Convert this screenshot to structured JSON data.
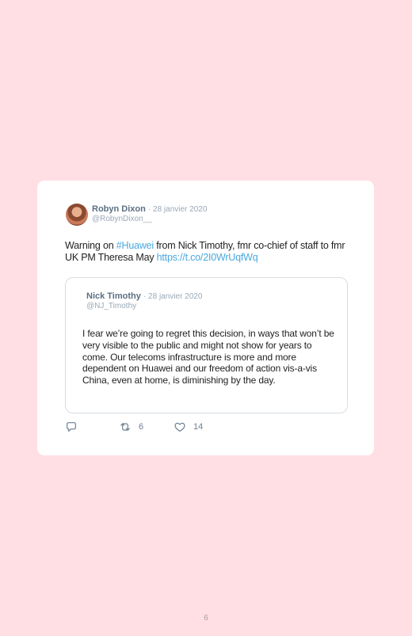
{
  "tweet": {
    "author": {
      "name": "Robyn Dixon",
      "date": "· 28 janvier 2020",
      "handle": "@RobynDixon__"
    },
    "text": {
      "prefix": "Warning on ",
      "hashtag": "#Huawei",
      "middle": " from Nick Timothy, fmr co-chief of staff to fmr UK PM Theresa May ",
      "link": "https://t.co/2I0WrUqfWq"
    },
    "quoted": {
      "name": "Nick Timothy",
      "date": "· 28 janvier 2020",
      "handle": "@NJ_Timothy",
      "text": "I fear we’re going to regret this decision, in ways that won’t be very visible to the public and might not show for years to come. Our telecoms infrastructure is more and more dependent on Huawei and our freedom of action vis-a-vis China, even at home, is diminishing by the day."
    },
    "actions": {
      "reply_icon": "reply-icon",
      "retweet_icon": "retweet-icon",
      "retweets": "6",
      "like_icon": "heart-icon",
      "likes": "14"
    }
  },
  "page": {
    "number": "6"
  },
  "colors": {
    "background": "#ffdfe3",
    "card": "#ffffff",
    "link": "#49a9df",
    "muted": "#9aa8b6"
  }
}
